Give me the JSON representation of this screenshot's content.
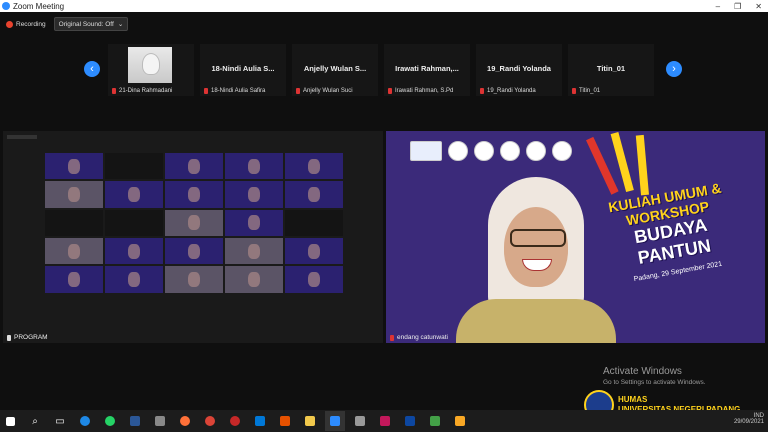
{
  "window": {
    "title": "Zoom Meeting",
    "controls": [
      "–",
      "❐",
      "✕"
    ]
  },
  "toolbar": {
    "recording_label": "Recording",
    "sound_button": "Original Sound: Off"
  },
  "participants": [
    {
      "name": "",
      "caption": "21-Dina Rahmadani"
    },
    {
      "name": "18-Nindi Aulia S...",
      "caption": "18-Nindi Aulia Safira"
    },
    {
      "name": "Anjelly Wulan S...",
      "caption": "Anjelly Wulan Suci"
    },
    {
      "name": "Irawati Rahman,...",
      "caption": "Irawati Rahman, S.Pd"
    },
    {
      "name": "19_Randi Yolanda",
      "caption": "19_Randi Yolanda"
    },
    {
      "name": "Titin_01",
      "caption": "Titin_01"
    }
  ],
  "left_panel": {
    "caption": "PROGRAM"
  },
  "right_panel": {
    "caption": "endang catunwati",
    "banner_line1": "KULIAH UMUM &",
    "banner_line2": "WORKSHOP",
    "banner_line3": "BUDAYA",
    "banner_line4": "PANTUN",
    "banner_date": "Padang, 29 September 2021"
  },
  "activation": {
    "title": "Activate Windows",
    "subtitle": "Go to Settings to activate Windows."
  },
  "branding": {
    "line1": "HUMAS",
    "line2": "UNIVERSITAS NEGERI PADANG"
  },
  "taskbar": {
    "tray_lang": "IND",
    "tray_date": "29/09/2021"
  },
  "colors": {
    "zoom_blue": "#2d8cff",
    "banner_purple": "#3b2a7a",
    "accent_yellow": "#ffd31c"
  }
}
